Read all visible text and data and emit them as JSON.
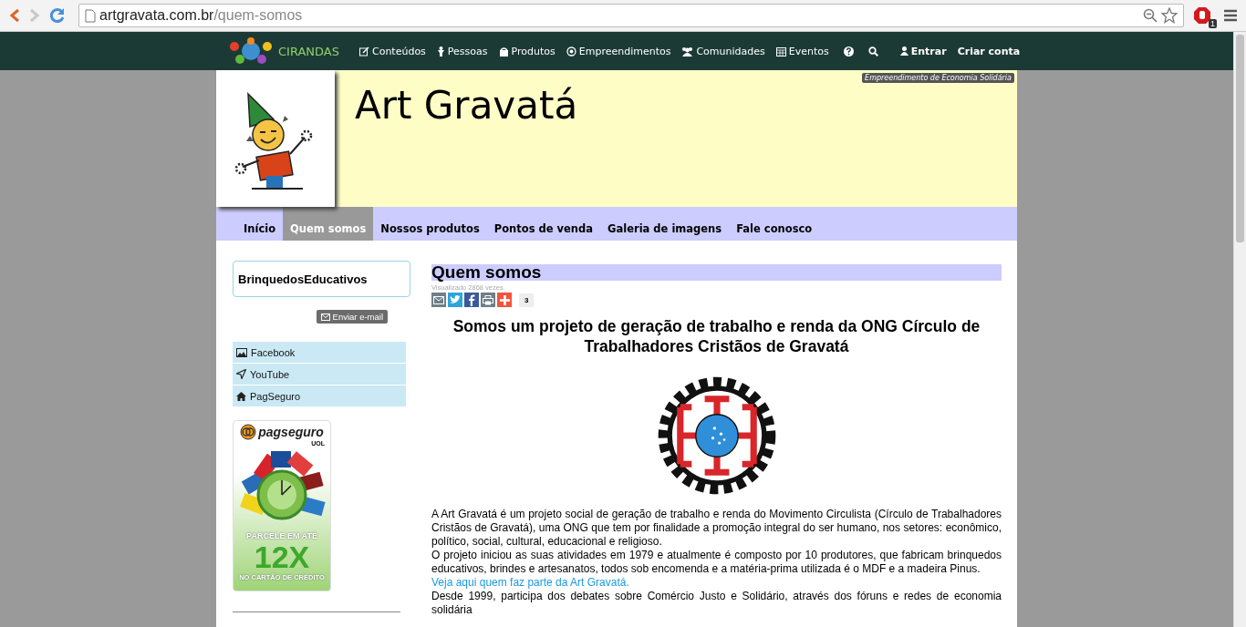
{
  "browser": {
    "url_host": "artgravata.com.br",
    "url_path": "/quem-somos",
    "extension_badge": "1"
  },
  "topnav": {
    "brand": "CIRANDAS",
    "items": [
      {
        "label": "Conteúdos",
        "kind": "content"
      },
      {
        "label": "Pessoas",
        "kind": "people"
      },
      {
        "label": "Produtos",
        "kind": "products"
      },
      {
        "label": "Empreendimentos",
        "kind": "enterprises"
      },
      {
        "label": "Comunidades",
        "kind": "communities"
      },
      {
        "label": "Eventos",
        "kind": "events"
      }
    ],
    "user_links": [
      {
        "label": "Entrar",
        "kind": "login"
      },
      {
        "label": "Criar conta",
        "kind": "signup"
      }
    ]
  },
  "header": {
    "title": "Art Gravatá",
    "tag": "Empreendimento de Economia Solidária"
  },
  "menu": [
    {
      "label": "Início",
      "selected": false
    },
    {
      "label": "Quem somos",
      "selected": true
    },
    {
      "label": "Nossos produtos",
      "selected": false
    },
    {
      "label": "Pontos de venda",
      "selected": false
    },
    {
      "label": "Galeria de imagens",
      "selected": false
    },
    {
      "label": "Fale conosco",
      "selected": false
    }
  ],
  "sidebar": {
    "box_title": "BrinquedosEducativos",
    "email_button": "Enviar e-mail",
    "links": [
      {
        "label": "Facebook",
        "kind": "image"
      },
      {
        "label": "YouTube",
        "kind": "send"
      },
      {
        "label": "PagSeguro",
        "kind": "home"
      }
    ],
    "banner": {
      "brand": "pagseguro",
      "sub": "UOL",
      "line1": "PARCELE EM ATÉ",
      "big": "12X",
      "line2": "NO CARTÃO DE CRÉDITO"
    }
  },
  "article": {
    "title": "Quem somos",
    "views": "Visualizado 2868 vezes",
    "share": [
      {
        "kind": "email",
        "color": "#6f7f88"
      },
      {
        "kind": "twitter",
        "color": "#2ea4dc"
      },
      {
        "kind": "facebook",
        "color": "#3b5998"
      },
      {
        "kind": "print",
        "color": "#6f7f88"
      },
      {
        "kind": "plus",
        "color": "#f0553a"
      }
    ],
    "share_count": "3",
    "subtitle": "Somos um projeto de geração de trabalho e renda da ONG Círculo de Trabalhadores Cristãos de Gravatá",
    "paragraphs": [
      {
        "text": "A Art Gravatá é um projeto social de geração de trabalho e renda do Movimento Circulista (Círculo de Trabalhadores Cristãos de Gravatá), uma ONG que tem por finalidade a promoção integral do ser humano, nos setores: econômico, político, social, cultural, educacional e religioso."
      },
      {
        "text": "O projeto iniciou as suas atividades em 1979 e atualmente é composto por 10 produtores, que fabricam brinquedos educativos, brindes e artesanatos, todos sob encomenda e a matéria-prima utilizada é o MDF e a madeira Pinus.",
        "link": "Veja aqui quem faz parte da Art Gravatá."
      },
      {
        "text": "Desde 1999, participa dos debates sobre Comércio Justo e Solidário, através dos fóruns e redes de economia solidária"
      }
    ]
  }
}
